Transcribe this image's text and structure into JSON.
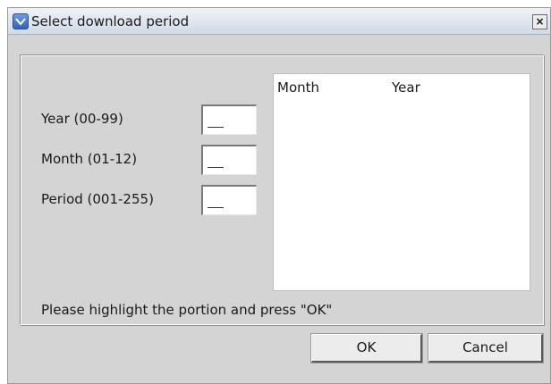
{
  "window": {
    "title": "Select download period",
    "close_label": "×"
  },
  "fields": {
    "year": {
      "label": "Year (00-99)",
      "value": ""
    },
    "month": {
      "label": "Month (01-12)",
      "value": ""
    },
    "period": {
      "label": "Period (001-255)",
      "value": ""
    }
  },
  "list": {
    "columns": [
      "Month",
      "Year"
    ],
    "rows": []
  },
  "hint": "Please highlight the portion and press \"OK\"",
  "buttons": {
    "ok_label": "OK",
    "cancel_label": "Cancel"
  },
  "icons": {
    "app": "download-dialog-icon",
    "close": "close-icon"
  }
}
